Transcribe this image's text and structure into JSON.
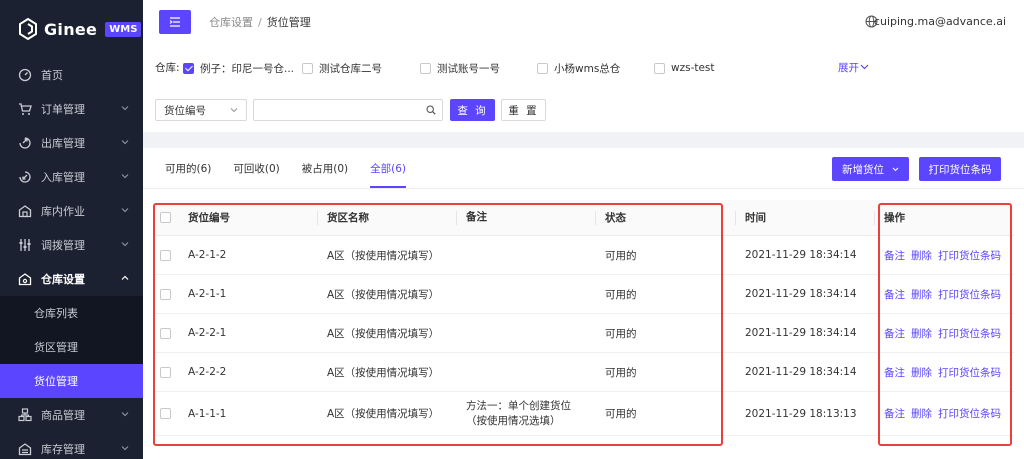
{
  "app": {
    "logo_text": "Ginee",
    "logo_badge": "WMS"
  },
  "sidebar": {
    "items": [
      {
        "label": "首页",
        "icon": "dashboard-icon"
      },
      {
        "label": "订单管理",
        "icon": "cart-icon"
      },
      {
        "label": "出库管理",
        "icon": "outbound-icon"
      },
      {
        "label": "入库管理",
        "icon": "inbound-icon"
      },
      {
        "label": "库内作业",
        "icon": "warehouse-icon"
      },
      {
        "label": "调拨管理",
        "icon": "transfer-icon"
      },
      {
        "label": "仓库设置",
        "icon": "settings-house-icon"
      },
      {
        "label": "商品管理",
        "icon": "product-icon"
      },
      {
        "label": "库存管理",
        "icon": "inventory-icon"
      }
    ],
    "sub_items": [
      {
        "label": "仓库列表"
      },
      {
        "label": "货区管理"
      },
      {
        "label": "货位管理"
      }
    ]
  },
  "header": {
    "breadcrumb_parent": "仓库设置",
    "breadcrumb_sep": "/",
    "breadcrumb_current": "货位管理",
    "user": "cuiping.ma@advance.ai"
  },
  "filter": {
    "warehouse_label": "仓库:",
    "warehouses": [
      {
        "name": "例子：印尼一号仓...",
        "checked": true
      },
      {
        "name": "测试仓库二号",
        "checked": false
      },
      {
        "name": "测试账号一号",
        "checked": false
      },
      {
        "name": "小杨wms总仓",
        "checked": false
      },
      {
        "name": "wzs-test",
        "checked": false
      }
    ],
    "expand": "展开",
    "search_field": "货位编号",
    "search_value": "",
    "query_btn": "查 询",
    "reset_btn": "重 置"
  },
  "tabs": [
    {
      "label": "可用的(6)",
      "active": false
    },
    {
      "label": "可回收(0)",
      "active": false
    },
    {
      "label": "被占用(0)",
      "active": false
    },
    {
      "label": "全部(6)",
      "active": true
    }
  ],
  "actions": {
    "add_label": "新增货位",
    "print_label": "打印货位条码"
  },
  "table": {
    "headers": {
      "code": "货位编号",
      "zone": "货区名称",
      "note": "备注",
      "status": "状态",
      "time": "时间",
      "ops": "操作"
    },
    "rows": [
      {
        "code": "A-2-1-2",
        "zone": "A区（按使用情况填写）",
        "note": "",
        "note2": "",
        "status": "可用的",
        "time": "2021-11-29 18:34:14"
      },
      {
        "code": "A-2-1-1",
        "zone": "A区（按使用情况填写）",
        "note": "",
        "note2": "",
        "status": "可用的",
        "time": "2021-11-29 18:34:14"
      },
      {
        "code": "A-2-2-1",
        "zone": "A区（按使用情况填写）",
        "note": "",
        "note2": "",
        "status": "可用的",
        "time": "2021-11-29 18:34:14"
      },
      {
        "code": "A-2-2-2",
        "zone": "A区（按使用情况填写）",
        "note": "",
        "note2": "",
        "status": "可用的",
        "time": "2021-11-29 18:34:14"
      },
      {
        "code": "A-1-1-1",
        "zone": "A区（按使用情况填写）",
        "note": "方法一：单个创建货位",
        "note2": "（按使用情况选填）",
        "status": "可用的",
        "time": "2021-11-29 18:13:13"
      }
    ],
    "op_labels": {
      "note": "备注",
      "delete": "删除",
      "print": "打印货位条码"
    }
  },
  "colors": {
    "accent": "#5b45ff",
    "sidebar_bg": "#1b2130",
    "highlight": "#e8403a"
  }
}
